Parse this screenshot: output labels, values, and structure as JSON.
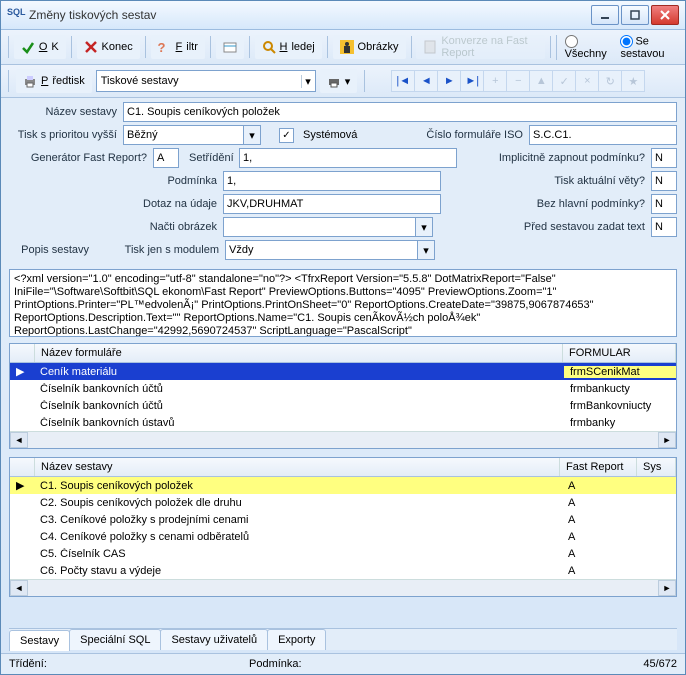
{
  "title": "Změny tiskových sestav",
  "toolbar": {
    "ok": "OK",
    "konec": "Konec",
    "filtr": "Filtr",
    "hledej": "Hledej",
    "obrazky": "Obrázky",
    "konverze": "Konverze na Fast Report",
    "vsechny": "Všechny",
    "sesestavou": "Se sestavou"
  },
  "toolbar2": {
    "predtisk": "Předtisk",
    "combo": "Tiskové sestavy"
  },
  "form": {
    "nazev_l": "Název sestavy",
    "nazev": "C1. Soupis ceníkových položek",
    "tiskprior_l": "Tisk s prioritou vyšší",
    "tiskprior": "Běžný",
    "systemova": "Systémová",
    "cislo_l": "Číslo formuláře ISO",
    "cislo": "S.C.C1.",
    "genfr_l": "Generátor Fast Report?",
    "genfr": "A",
    "setrideni_l": "Setřídění",
    "setrideni": "1,",
    "impl_l": "Implicitně zapnout podmínku?",
    "impl": "N",
    "podm_l": "Podmínka",
    "podm": "1,",
    "aktvety_l": "Tisk aktuální věty?",
    "aktvety": "N",
    "dotaz_l": "Dotaz na údaje",
    "dotaz": "JKV,DRUHMAT",
    "bezhl_l": "Bez hlavní podmínky?",
    "bezhl": "N",
    "nactiobr_l": "Načti obrázek",
    "nactiobr": "",
    "predse_l": "Před sestavou zadat text",
    "predse": "N",
    "tiskmod_l": "Tisk jen s modulem",
    "tiskmod": "Vždy",
    "popis_l": "Popis sestavy"
  },
  "xml": "<?xml version=\"1.0\" encoding=\"utf-8\" standalone=\"no\"?>\n<TfrxReport Version=\"5.5.8\" DotMatrixReport=\"False\" IniFile=\"\\Software\\Softbit\\SQL ekonom\\Fast Report\" PreviewOptions.Buttons=\"4095\" PreviewOptions.Zoom=\"1\" PrintOptions.Printer=\"PL™edvolenÃ¡\" PrintOptions.PrintOnSheet=\"0\" ReportOptions.CreateDate=\"39875,9067874653\" ReportOptions.Description.Text=\"\" ReportOptions.Name=\"C1. Soupis cenÃ­kovÃ½ch poloÅ¾ek\" ReportOptions.LastChange=\"42992,5690724537\" ScriptLanguage=\"PascalScript\"",
  "grid1": {
    "h1": "Název formuláře",
    "h2": "FORMULAR",
    "rows": [
      {
        "n": "Ceník materiálu",
        "f": "frmSCenikMat"
      },
      {
        "n": "Číselník bankovních účtů",
        "f": "frmbankucty"
      },
      {
        "n": "Číselník bankovních účtů",
        "f": "frmBankovniucty"
      },
      {
        "n": "Číselník bankovních ústavů",
        "f": "frmbanky"
      }
    ]
  },
  "grid2": {
    "h1": "Název sestavy",
    "h2": "Fast Report",
    "h3": "Sys",
    "rows": [
      {
        "n": "C1. Soupis ceníkových položek",
        "f": "A"
      },
      {
        "n": "C2. Soupis ceníkových položek dle druhu",
        "f": "A"
      },
      {
        "n": "C3. Ceníkové položky s prodejními cenami",
        "f": "A"
      },
      {
        "n": "C4. Ceníkové položky s cenami odběratelů",
        "f": "A"
      },
      {
        "n": "C5. Číselník CAS",
        "f": "A"
      },
      {
        "n": "C6. Počty stavu a výdeje",
        "f": "A"
      }
    ]
  },
  "tabs": {
    "t1": "Sestavy",
    "t2": "Speciální SQL",
    "t3": "Sestavy uživatelů",
    "t4": "Exporty"
  },
  "status": {
    "trideni": "Třídění:",
    "podm": "Podmínka:",
    "count": "45/672"
  }
}
